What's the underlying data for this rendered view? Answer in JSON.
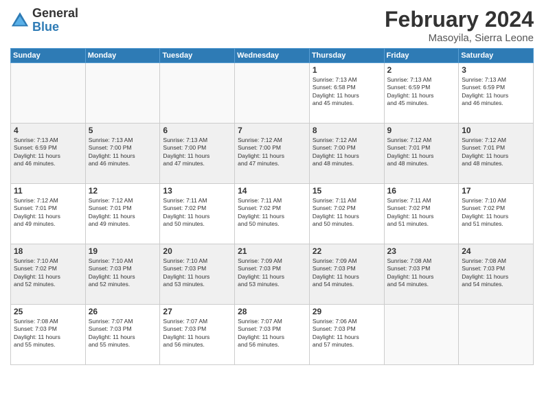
{
  "logo": {
    "general": "General",
    "blue": "Blue"
  },
  "title": {
    "month_year": "February 2024",
    "location": "Masoyila, Sierra Leone"
  },
  "headers": [
    "Sunday",
    "Monday",
    "Tuesday",
    "Wednesday",
    "Thursday",
    "Friday",
    "Saturday"
  ],
  "weeks": [
    [
      {
        "day": "",
        "info": ""
      },
      {
        "day": "",
        "info": ""
      },
      {
        "day": "",
        "info": ""
      },
      {
        "day": "",
        "info": ""
      },
      {
        "day": "1",
        "info": "Sunrise: 7:13 AM\nSunset: 6:58 PM\nDaylight: 11 hours\nand 45 minutes."
      },
      {
        "day": "2",
        "info": "Sunrise: 7:13 AM\nSunset: 6:59 PM\nDaylight: 11 hours\nand 45 minutes."
      },
      {
        "day": "3",
        "info": "Sunrise: 7:13 AM\nSunset: 6:59 PM\nDaylight: 11 hours\nand 46 minutes."
      }
    ],
    [
      {
        "day": "4",
        "info": "Sunrise: 7:13 AM\nSunset: 6:59 PM\nDaylight: 11 hours\nand 46 minutes."
      },
      {
        "day": "5",
        "info": "Sunrise: 7:13 AM\nSunset: 7:00 PM\nDaylight: 11 hours\nand 46 minutes."
      },
      {
        "day": "6",
        "info": "Sunrise: 7:13 AM\nSunset: 7:00 PM\nDaylight: 11 hours\nand 47 minutes."
      },
      {
        "day": "7",
        "info": "Sunrise: 7:12 AM\nSunset: 7:00 PM\nDaylight: 11 hours\nand 47 minutes."
      },
      {
        "day": "8",
        "info": "Sunrise: 7:12 AM\nSunset: 7:00 PM\nDaylight: 11 hours\nand 48 minutes."
      },
      {
        "day": "9",
        "info": "Sunrise: 7:12 AM\nSunset: 7:01 PM\nDaylight: 11 hours\nand 48 minutes."
      },
      {
        "day": "10",
        "info": "Sunrise: 7:12 AM\nSunset: 7:01 PM\nDaylight: 11 hours\nand 48 minutes."
      }
    ],
    [
      {
        "day": "11",
        "info": "Sunrise: 7:12 AM\nSunset: 7:01 PM\nDaylight: 11 hours\nand 49 minutes."
      },
      {
        "day": "12",
        "info": "Sunrise: 7:12 AM\nSunset: 7:01 PM\nDaylight: 11 hours\nand 49 minutes."
      },
      {
        "day": "13",
        "info": "Sunrise: 7:11 AM\nSunset: 7:02 PM\nDaylight: 11 hours\nand 50 minutes."
      },
      {
        "day": "14",
        "info": "Sunrise: 7:11 AM\nSunset: 7:02 PM\nDaylight: 11 hours\nand 50 minutes."
      },
      {
        "day": "15",
        "info": "Sunrise: 7:11 AM\nSunset: 7:02 PM\nDaylight: 11 hours\nand 50 minutes."
      },
      {
        "day": "16",
        "info": "Sunrise: 7:11 AM\nSunset: 7:02 PM\nDaylight: 11 hours\nand 51 minutes."
      },
      {
        "day": "17",
        "info": "Sunrise: 7:10 AM\nSunset: 7:02 PM\nDaylight: 11 hours\nand 51 minutes."
      }
    ],
    [
      {
        "day": "18",
        "info": "Sunrise: 7:10 AM\nSunset: 7:02 PM\nDaylight: 11 hours\nand 52 minutes."
      },
      {
        "day": "19",
        "info": "Sunrise: 7:10 AM\nSunset: 7:03 PM\nDaylight: 11 hours\nand 52 minutes."
      },
      {
        "day": "20",
        "info": "Sunrise: 7:10 AM\nSunset: 7:03 PM\nDaylight: 11 hours\nand 53 minutes."
      },
      {
        "day": "21",
        "info": "Sunrise: 7:09 AM\nSunset: 7:03 PM\nDaylight: 11 hours\nand 53 minutes."
      },
      {
        "day": "22",
        "info": "Sunrise: 7:09 AM\nSunset: 7:03 PM\nDaylight: 11 hours\nand 54 minutes."
      },
      {
        "day": "23",
        "info": "Sunrise: 7:08 AM\nSunset: 7:03 PM\nDaylight: 11 hours\nand 54 minutes."
      },
      {
        "day": "24",
        "info": "Sunrise: 7:08 AM\nSunset: 7:03 PM\nDaylight: 11 hours\nand 54 minutes."
      }
    ],
    [
      {
        "day": "25",
        "info": "Sunrise: 7:08 AM\nSunset: 7:03 PM\nDaylight: 11 hours\nand 55 minutes."
      },
      {
        "day": "26",
        "info": "Sunrise: 7:07 AM\nSunset: 7:03 PM\nDaylight: 11 hours\nand 55 minutes."
      },
      {
        "day": "27",
        "info": "Sunrise: 7:07 AM\nSunset: 7:03 PM\nDaylight: 11 hours\nand 56 minutes."
      },
      {
        "day": "28",
        "info": "Sunrise: 7:07 AM\nSunset: 7:03 PM\nDaylight: 11 hours\nand 56 minutes."
      },
      {
        "day": "29",
        "info": "Sunrise: 7:06 AM\nSunset: 7:03 PM\nDaylight: 11 hours\nand 57 minutes."
      },
      {
        "day": "",
        "info": ""
      },
      {
        "day": "",
        "info": ""
      }
    ]
  ]
}
